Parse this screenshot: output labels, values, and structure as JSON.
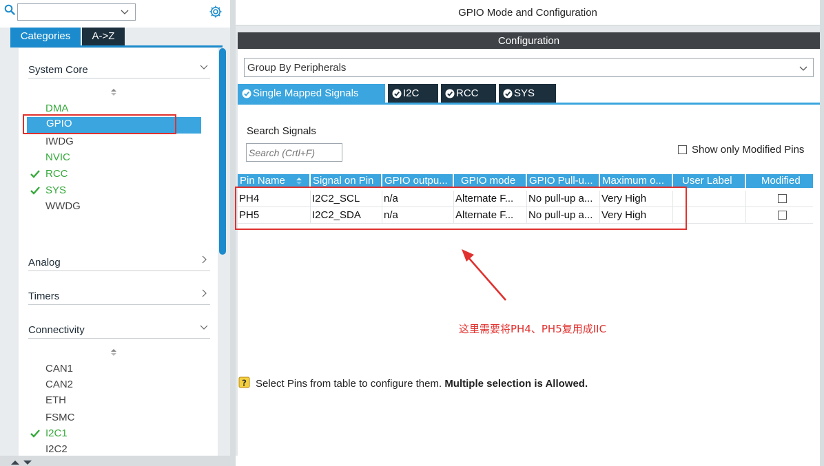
{
  "left_panel": {
    "tabs": {
      "categories": "Categories",
      "atoz": "A->Z"
    },
    "groups": {
      "system_core": "System Core",
      "analog": "Analog",
      "timers": "Timers",
      "connectivity": "Connectivity"
    },
    "system_core_items": [
      {
        "label": "DMA",
        "state": "green"
      },
      {
        "label": "GPIO",
        "state": "selected"
      },
      {
        "label": "IWDG",
        "state": "normal"
      },
      {
        "label": "NVIC",
        "state": "green"
      },
      {
        "label": "RCC",
        "state": "checked"
      },
      {
        "label": "SYS",
        "state": "checked"
      },
      {
        "label": "WWDG",
        "state": "normal"
      }
    ],
    "connectivity_items": [
      {
        "label": "CAN1",
        "state": "normal"
      },
      {
        "label": "CAN2",
        "state": "normal"
      },
      {
        "label": "ETH",
        "state": "normal"
      },
      {
        "label": "FSMC",
        "state": "normal"
      },
      {
        "label": "I2C1",
        "state": "checked"
      },
      {
        "label": "I2C2",
        "state": "normal"
      }
    ]
  },
  "header": {
    "title": "GPIO Mode and Configuration"
  },
  "configuration": {
    "bar_title": "Configuration",
    "group_by": "Group By Peripherals",
    "tabs": {
      "single": "Single Mapped Signals",
      "i2c": "I2C",
      "rcc": "RCC",
      "sys": "SYS"
    },
    "search_label": "Search Signals",
    "search_placeholder": "Search (Crtl+F)",
    "modified_only_label": "Show only Modified Pins"
  },
  "table": {
    "headers": [
      "Pin Name",
      "Signal on Pin",
      "GPIO outpu...",
      "GPIO mode",
      "GPIO Pull-u...",
      "Maximum o...",
      "User Label",
      "Modified"
    ],
    "rows": [
      [
        "PH4",
        "I2C2_SCL",
        "n/a",
        "Alternate F...",
        "No pull-up a...",
        "Very High",
        "",
        false
      ],
      [
        "PH5",
        "I2C2_SDA",
        "n/a",
        "Alternate F...",
        "No pull-up a...",
        "Very High",
        "",
        false
      ]
    ]
  },
  "annotation": "这里需要将PH4、PH5复用成IIC",
  "hint": {
    "text": "Select Pins from table to configure them.",
    "bold": "Multiple selection is Allowed."
  },
  "colors": {
    "accent": "#3aa5de",
    "dark_tab": "#1c2f3d",
    "green": "#35a93a",
    "annotation_red": "#e0312e"
  }
}
